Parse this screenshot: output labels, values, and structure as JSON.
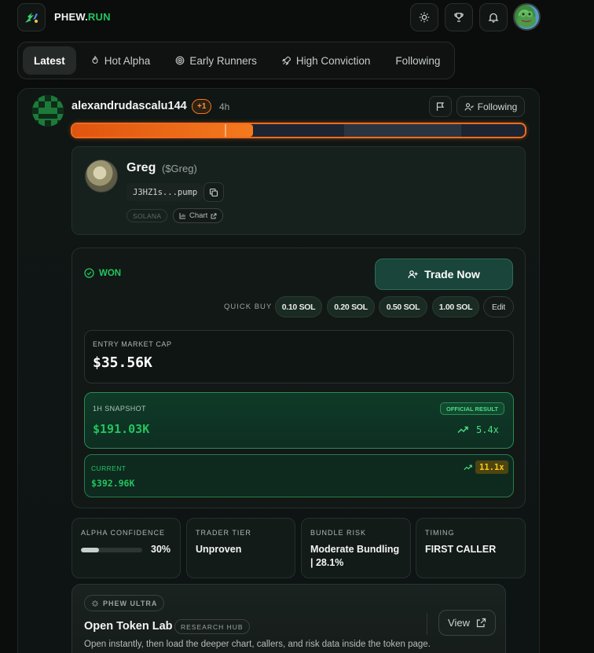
{
  "app": {
    "brand_part1": "PHEW.",
    "brand_part2": "RUN",
    "logo_icon": "phew-logo-icon",
    "theme_icon": "sun-icon",
    "trophy_icon": "trophy-icon",
    "bell_icon": "bell-icon"
  },
  "tabs": [
    {
      "label": "Latest",
      "icon": "",
      "active": true
    },
    {
      "label": "Hot Alpha",
      "icon": "flame-icon"
    },
    {
      "label": "Early Runners",
      "icon": "target-icon"
    },
    {
      "label": "High Conviction",
      "icon": "rocket-icon"
    },
    {
      "label": "Following",
      "icon": ""
    }
  ],
  "post": {
    "username": "alexandrudascalu144",
    "plus_badge": "+1",
    "time_ago": "4h",
    "follow_label": "Following",
    "progress_fraction": 0.4
  },
  "token": {
    "name": "Greg",
    "symbol": "($Greg)",
    "contract": "J3HZ1s...pump",
    "chain": "SOLANA",
    "chart_label": "Chart"
  },
  "result": {
    "status": "WON",
    "trade_label": "Trade Now",
    "quick_buy_label": "QUICK BUY",
    "quick_buy_options": [
      "0.10 SOL",
      "0.20 SOL",
      "0.50 SOL",
      "1.00 SOL"
    ],
    "edit_label": "Edit",
    "entry_label": "ENTRY MARKET CAP",
    "entry_value": "$35.56K",
    "snapshot_label": "1H SNAPSHOT",
    "official_label": "OFFICIAL RESULT",
    "snapshot_value": "$191.03K",
    "snapshot_mult": "5.4x",
    "current_label": "CURRENT",
    "current_value": "$392.96K",
    "current_mult": "11.1x"
  },
  "stats": {
    "confidence_label": "ALPHA CONFIDENCE",
    "confidence_value": "30%",
    "confidence_fraction": 0.3,
    "tier_label": "TRADER TIER",
    "tier_value": "Unproven",
    "bundle_label": "BUNDLE RISK",
    "bundle_line1": "Moderate Bundling",
    "bundle_line2": "| 28.1%",
    "timing_label": "TIMING",
    "timing_value": "FIRST CALLER"
  },
  "ultra": {
    "tag": "PHEW ULTRA",
    "title": "Open Token Lab",
    "hub_tag": "RESEARCH HUB",
    "subtitle": "Open instantly, then load the deeper chart, callers, and risk data inside the token page.",
    "view_label": "View"
  },
  "colors": {
    "accent_green": "#22c55e",
    "accent_orange": "#f97316",
    "multiplier_yellow": "#facc15"
  }
}
